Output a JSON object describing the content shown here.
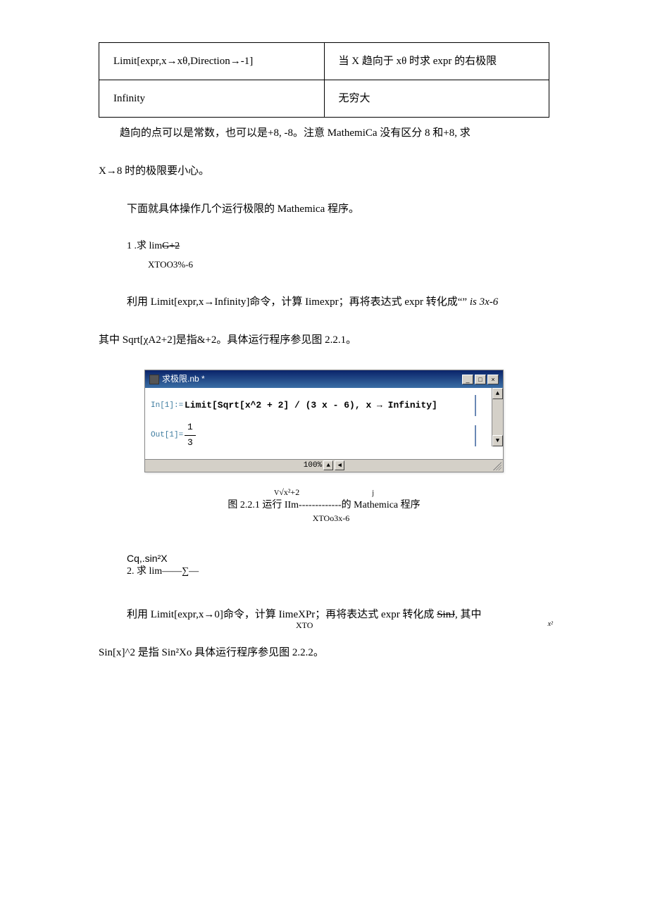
{
  "table": {
    "row1": {
      "col1": "Limit[expr,x→xθ,Direction→-1]",
      "col2": "当 X 趋向于 xθ 时求 expr 的右极限"
    },
    "row2": {
      "col1": "Infinity",
      "col2": "无穷大"
    }
  },
  "p1": "趋向的点可以是常数，也可以是+8, -8。注意 MathemiCa 没有区分 8 和+8, 求",
  "p1b": "X→8 时的极限要小心。",
  "p2": "下面就具体操作几个运行极限的 Mathemica 程序。",
  "prob1": {
    "num": "1 .求 lim",
    "strike": "G+2",
    "den": "XTOO3%-6"
  },
  "p3": "利用 Limit[expr,x→Infinity]命令，计算 Iimexpr；再将表达式 expr 转化成“” ",
  "p3i": "is    3x-6",
  "p4": "其中 Sqrt[χA2+2]是指&+2。具体运行程序参见图 2.2.1。",
  "window": {
    "title": "求极限.nb *",
    "input_label": "In[1]:=",
    "input_code": "Limit[Sqrt[x^2 + 2] / (3 x - 6), x → Infinity]",
    "output_label": "Out[1]=",
    "output_val_top": "1",
    "output_val_bot": "3",
    "zoom": "100%",
    "min": "_",
    "max": "□",
    "close": "×",
    "up": "▲",
    "down": "▼",
    "left": "◀",
    "scroll_up": "▲",
    "scroll_down": "▼"
  },
  "caption": {
    "l1a": "V",
    "l1b": "√x²+2",
    "l1c": "j",
    "l2": "图 2.2.1 运行 IIm-------------的 Mathemica 程序",
    "l3": "XTOo3x-6"
  },
  "prob2": {
    "l1": "Cq,.sin²X",
    "l2": "2. 求 lim——∑—"
  },
  "p5a": "利用 Limit[expr,x→0]命令，计算 IimeXPr；再将表达式 expr 转化成 ",
  "p5strike": "SinJ",
  "p5b": ", 其中",
  "p5sub": "XTO",
  "p5annot": "x²",
  "p6": "Sin[x]^2 是指 Sin²Xo 具体运行程序参见图 2.2.2。"
}
